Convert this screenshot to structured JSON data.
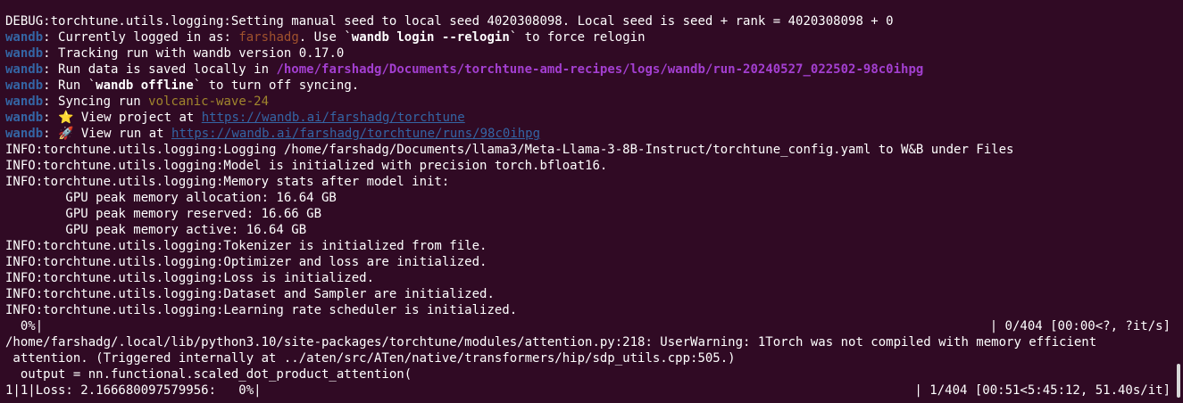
{
  "terminal": {
    "lines": [
      {
        "segments": [
          {
            "t": "DEBUG:torchtune.utils.logging:Setting manual seed to local seed 4020308098. Local seed is seed + rank = 4020308098 + 0",
            "s": ""
          }
        ]
      },
      {
        "segments": [
          {
            "t": "wandb",
            "s": "wandb"
          },
          {
            "t": ": Currently logged in as: ",
            "s": ""
          },
          {
            "t": "farshadg",
            "s": "user"
          },
          {
            "t": ". Use `",
            "s": ""
          },
          {
            "t": "wandb login --relogin",
            "s": "bold"
          },
          {
            "t": "` to force relogin",
            "s": ""
          }
        ]
      },
      {
        "segments": [
          {
            "t": "wandb",
            "s": "wandb"
          },
          {
            "t": ": Tracking run with wandb version 0.17.0",
            "s": ""
          }
        ]
      },
      {
        "segments": [
          {
            "t": "wandb",
            "s": "wandb"
          },
          {
            "t": ": Run data is saved locally in ",
            "s": ""
          },
          {
            "t": "/home/farshadg/Documents/torchtune-amd-recipes/logs/wandb/run-20240527_022502-98c0ihpg",
            "s": "path"
          }
        ]
      },
      {
        "segments": [
          {
            "t": "wandb",
            "s": "wandb"
          },
          {
            "t": ": Run `",
            "s": ""
          },
          {
            "t": "wandb offline",
            "s": "bold"
          },
          {
            "t": "` to turn off syncing.",
            "s": ""
          }
        ]
      },
      {
        "segments": [
          {
            "t": "wandb",
            "s": "wandb"
          },
          {
            "t": ": Syncing run ",
            "s": ""
          },
          {
            "t": "volcanic-wave-24",
            "s": "runname"
          }
        ]
      },
      {
        "segments": [
          {
            "t": "wandb",
            "s": "wandb"
          },
          {
            "t": ": ⭐ View project at ",
            "s": ""
          },
          {
            "t": "https://wandb.ai/farshadg/torchtune",
            "s": "link"
          }
        ]
      },
      {
        "segments": [
          {
            "t": "wandb",
            "s": "wandb"
          },
          {
            "t": ": 🚀 View run at ",
            "s": ""
          },
          {
            "t": "https://wandb.ai/farshadg/torchtune/runs/98c0ihpg",
            "s": "link"
          }
        ]
      },
      {
        "segments": [
          {
            "t": "INFO:torchtune.utils.logging:Logging /home/farshadg/Documents/llama3/Meta-Llama-3-8B-Instruct/torchtune_config.yaml to W&B under Files",
            "s": ""
          }
        ]
      },
      {
        "segments": [
          {
            "t": "INFO:torchtune.utils.logging:Model is initialized with precision torch.bfloat16.",
            "s": ""
          }
        ]
      },
      {
        "segments": [
          {
            "t": "INFO:torchtune.utils.logging:Memory stats after model init:",
            "s": ""
          }
        ]
      },
      {
        "segments": [
          {
            "t": "        GPU peak memory allocation: 16.64 GB",
            "s": ""
          }
        ]
      },
      {
        "segments": [
          {
            "t": "        GPU peak memory reserved: 16.66 GB",
            "s": ""
          }
        ]
      },
      {
        "segments": [
          {
            "t": "        GPU peak memory active: 16.64 GB",
            "s": ""
          }
        ]
      },
      {
        "segments": [
          {
            "t": "INFO:torchtune.utils.logging:Tokenizer is initialized from file.",
            "s": ""
          }
        ]
      },
      {
        "segments": [
          {
            "t": "INFO:torchtune.utils.logging:Optimizer and loss are initialized.",
            "s": ""
          }
        ]
      },
      {
        "segments": [
          {
            "t": "INFO:torchtune.utils.logging:Loss is initialized.",
            "s": ""
          }
        ]
      },
      {
        "segments": [
          {
            "t": "INFO:torchtune.utils.logging:Dataset and Sampler are initialized.",
            "s": ""
          }
        ]
      },
      {
        "segments": [
          {
            "t": "INFO:torchtune.utils.logging:Learning rate scheduler is initialized.",
            "s": ""
          }
        ]
      },
      {
        "segments": [
          {
            "t": "  0%|",
            "s": ""
          }
        ],
        "right": "| 0/404 [00:00<?, ?it/s]"
      },
      {
        "segments": [
          {
            "t": "/home/farshadg/.local/lib/python3.10/site-packages/torchtune/modules/attention.py:218: UserWarning: 1Torch was not compiled with memory efficient",
            "s": ""
          }
        ]
      },
      {
        "segments": [
          {
            "t": " attention. (Triggered internally at ../aten/src/ATen/native/transformers/hip/sdp_utils.cpp:505.)",
            "s": ""
          }
        ]
      },
      {
        "segments": [
          {
            "t": "  output = nn.functional.scaled_dot_product_attention(",
            "s": ""
          }
        ]
      },
      {
        "segments": [
          {
            "t": "1|1|Loss: 2.166680097579956:   0%|",
            "s": ""
          }
        ],
        "right": "| 1/404 [00:51<5:45:12, 51.40s/it]"
      }
    ]
  },
  "colors": {
    "background": "#300a24",
    "foreground": "#ffffff",
    "wandb_prefix": "#3465a4",
    "username": "#a0522d",
    "path": "#a33fd0",
    "link": "#3465a4",
    "run_name": "#a0852d",
    "scrollbar_thumb": "#d8d8d8"
  },
  "icons": [
    "star-icon",
    "rocket-icon"
  ]
}
